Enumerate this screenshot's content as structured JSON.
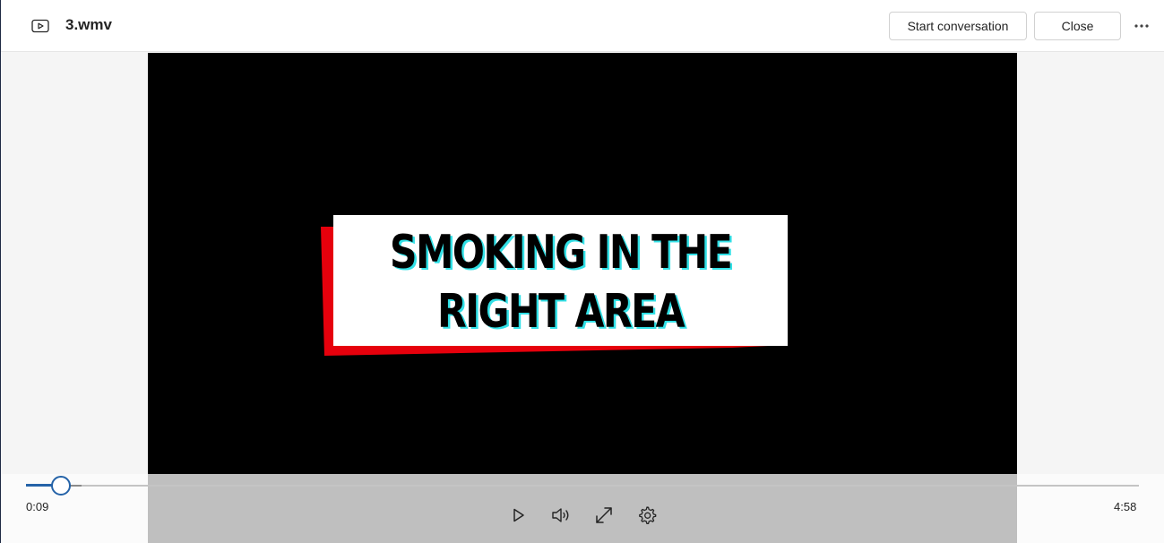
{
  "header": {
    "file_title": "3.wmv",
    "file_icon": "video-file-icon",
    "start_conversation_label": "Start conversation",
    "close_label": "Close",
    "more_icon": "more-options-icon"
  },
  "video": {
    "title_line1": "SMOKING IN THE",
    "title_line2": "RIGHT AREA",
    "colors": {
      "accent_red": "#e6000c",
      "text_shadow_cyan": "#31e0e6"
    }
  },
  "player": {
    "current_time": "0:09",
    "total_time": "4:58",
    "progress_fraction": 0.03,
    "accent": "#2563a8",
    "controls": [
      "play-icon",
      "volume-icon",
      "fullscreen-icon",
      "settings-icon"
    ]
  }
}
